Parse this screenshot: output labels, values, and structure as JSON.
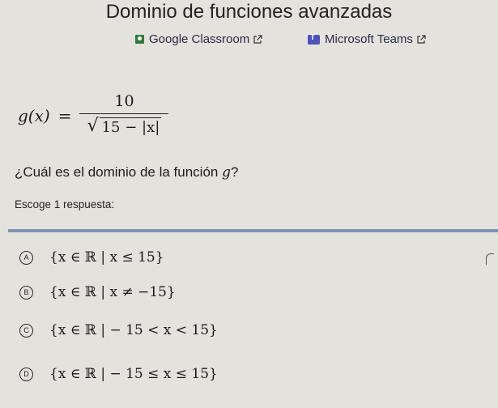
{
  "page_title": "Dominio de funciones avanzadas",
  "share": {
    "google_classroom": "Google Classroom",
    "microsoft_teams": "Microsoft Teams"
  },
  "formula": {
    "lhs": "g(x)",
    "equals": "=",
    "numerator": "10",
    "denominator_radicand": "15 − |x|"
  },
  "question": {
    "text_before": "¿Cuál es el dominio de la función ",
    "variable": "g",
    "text_after": "?"
  },
  "instruction": "Escoge 1 respuesta:",
  "options": [
    {
      "letter": "A",
      "text": "{x ∈ ℝ | x ≤ 15}"
    },
    {
      "letter": "B",
      "text": "{x ∈ ℝ | x ≠ −15}"
    },
    {
      "letter": "C",
      "text": "{x ∈ ℝ | − 15 < x < 15}"
    },
    {
      "letter": "D",
      "text": "{x ∈ ℝ | − 15 ≤ x ≤ 15}"
    }
  ],
  "colors": {
    "background": "#e4e2dc",
    "divider": "#7f95b3",
    "google_classroom": "#2f7a3c",
    "microsoft_teams": "#4b53bc"
  }
}
